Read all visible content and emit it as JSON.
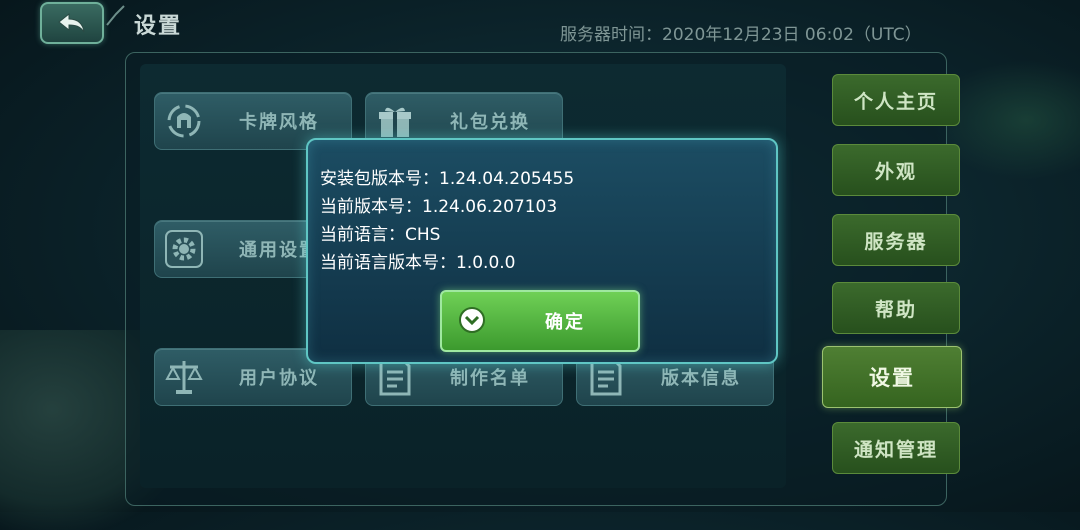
{
  "header": {
    "title": "设置",
    "server_time": "服务器时间：2020年12月23日 06:02（UTC）"
  },
  "tiles": [
    {
      "label": "卡牌风格",
      "icon": "helmet-icon"
    },
    {
      "label": "礼包兑换",
      "icon": "gift-icon"
    },
    {
      "label": "通用设置",
      "icon": "gear-icon"
    },
    {
      "label": "用户协议",
      "icon": "scale-icon"
    },
    {
      "label": "制作名单",
      "icon": "document-icon"
    },
    {
      "label": "版本信息",
      "icon": "document-icon"
    }
  ],
  "nav": {
    "items": [
      {
        "label": "个人主页"
      },
      {
        "label": "外观"
      },
      {
        "label": "服务器"
      },
      {
        "label": "帮助"
      },
      {
        "label": "设置",
        "active": true
      },
      {
        "label": "通知管理"
      }
    ]
  },
  "dialog": {
    "lines": [
      "安装包版本号：1.24.04.205455",
      "当前版本号：1.24.06.207103",
      "当前语言：CHS",
      "当前语言版本号：1.0.0.0"
    ],
    "confirm_label": "确定"
  },
  "colors": {
    "accent_teal": "#5fc6c4",
    "nav_green": "#3b6a2c",
    "confirm_green": "#6fd056"
  }
}
